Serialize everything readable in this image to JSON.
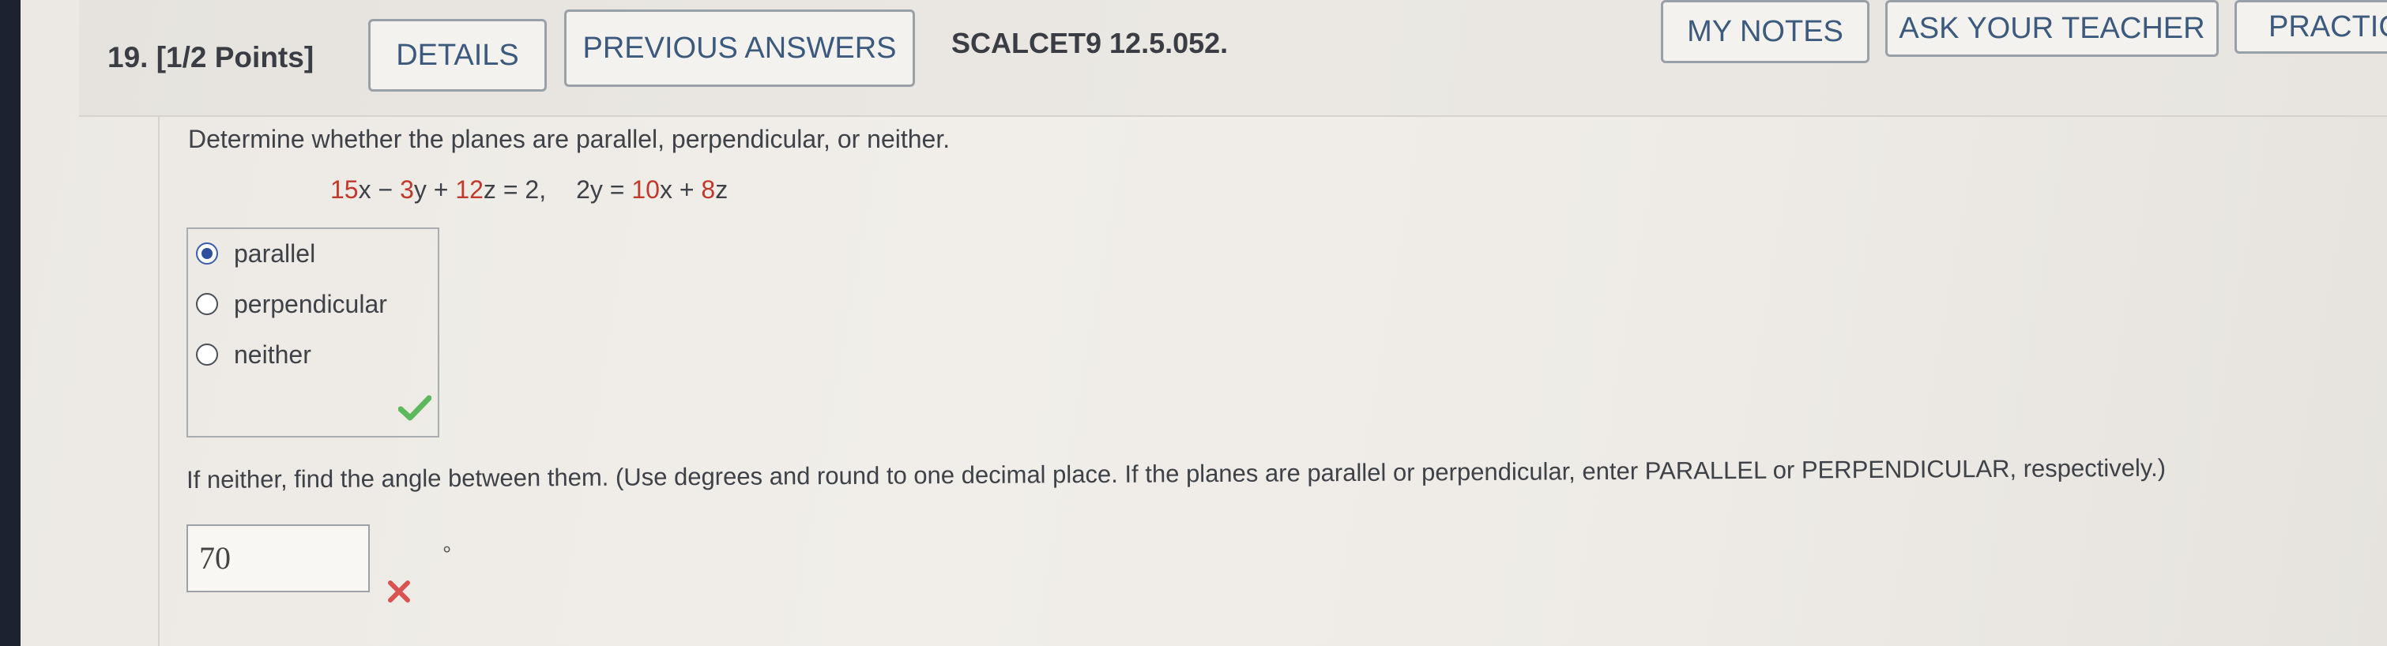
{
  "header": {
    "question_number": "19.",
    "points": "[1/2 Points]",
    "details_label": "DETAILS",
    "previous_answers_label": "PREVIOUS ANSWERS",
    "course_code": "SCALCET9 12.5.052.",
    "my_notes_label": "MY NOTES",
    "ask_teacher_label": "ASK YOUR TEACHER",
    "practice_label": "PRACTICE"
  },
  "question": {
    "prompt": "Determine whether the planes are parallel, perpendicular, or neither.",
    "equation": {
      "c1": "15",
      "t1": "x − ",
      "c2": "3",
      "t2": "y + ",
      "c3": "12",
      "t3": "z = 2,",
      "t4": "2y = ",
      "c4": "10",
      "t5": "x + ",
      "c5": "8",
      "t6": "z"
    },
    "choices": [
      {
        "label": "parallel",
        "selected": true
      },
      {
        "label": "perpendicular",
        "selected": false
      },
      {
        "label": "neither",
        "selected": false
      }
    ],
    "choice_status": "correct"
  },
  "followup": {
    "prompt": "If neither, find the angle between them. (Use degrees and round to one decimal place. If the planes are parallel or perpendicular, enter PARALLEL or PERPENDICULAR, respectively.)",
    "answer_value": "70",
    "unit": "°",
    "answer_status": "incorrect"
  },
  "colors": {
    "accent_blue": "#3c5a7e",
    "correct_green": "#5cb85c",
    "incorrect_red": "#d9534f",
    "coefficient_red": "#c0392b"
  }
}
